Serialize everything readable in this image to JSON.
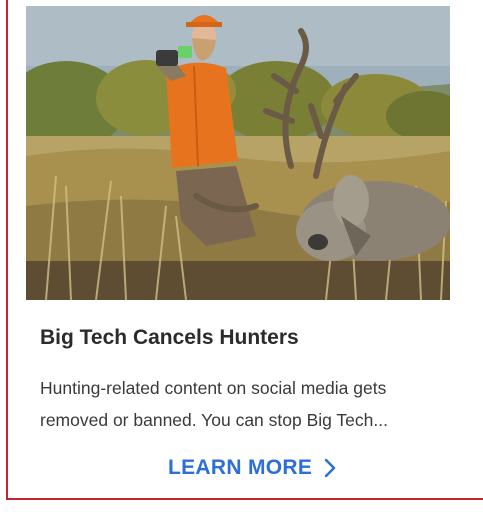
{
  "ad": {
    "headline": "Big Tech Cancels Hunters",
    "body": "Hunting-related content on social media gets removed or banned. You can stop Big Tech...",
    "cta_label": "LEARN MORE",
    "cta_icon": "chevron-right-icon",
    "image_subject": "hunter-with-deer-photo"
  },
  "colors": {
    "accent_border": "#c8232c",
    "cta": "#2d6fd6",
    "headline": "#2b2b2b",
    "body": "#3a3a3a"
  }
}
